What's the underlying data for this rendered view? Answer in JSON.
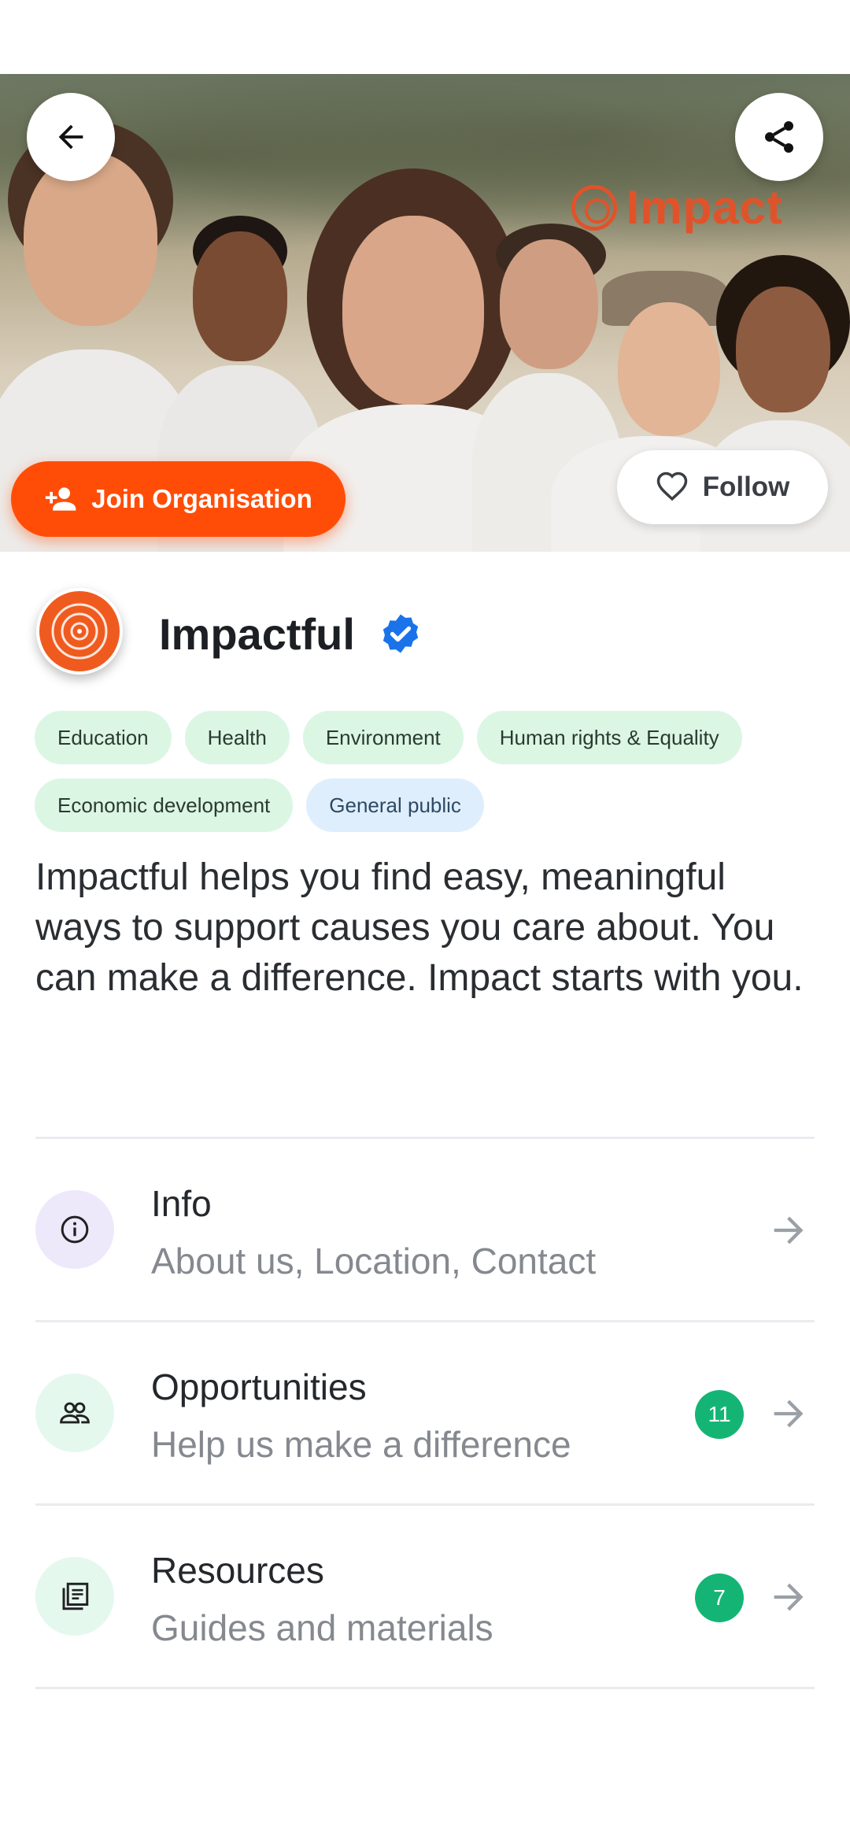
{
  "hero": {
    "brand_word": "Impact",
    "join_label": "Join Organisation",
    "follow_label": "Follow"
  },
  "organisation": {
    "name": "Impactful",
    "verified": true,
    "tags": [
      {
        "label": "Education",
        "kind": "category"
      },
      {
        "label": "Health",
        "kind": "category"
      },
      {
        "label": "Environment",
        "kind": "category"
      },
      {
        "label": "Human rights & Equality",
        "kind": "category"
      },
      {
        "label": "Economic development",
        "kind": "category"
      },
      {
        "label": "General public",
        "kind": "audience"
      }
    ],
    "description": "Impactful helps you find easy, meaningful ways to support causes you care about. You can make a difference.  Impact starts with you."
  },
  "sections": [
    {
      "title": "Info",
      "subtitle": "About us, Location, Contact",
      "icon": "info-icon",
      "badge": null
    },
    {
      "title": "Opportunities",
      "subtitle": "Help us make a difference",
      "icon": "people-icon",
      "badge": "11"
    },
    {
      "title": "Resources",
      "subtitle": "Guides and materials",
      "icon": "document-icon",
      "badge": "7"
    }
  ],
  "colors": {
    "accent_orange": "#ff4d08",
    "brand_orange": "#ef5b1f",
    "verified_blue": "#1a73e8",
    "badge_green": "#14b574",
    "tag_green_bg": "#dcf6e4",
    "tag_blue_bg": "#dfeefc"
  }
}
